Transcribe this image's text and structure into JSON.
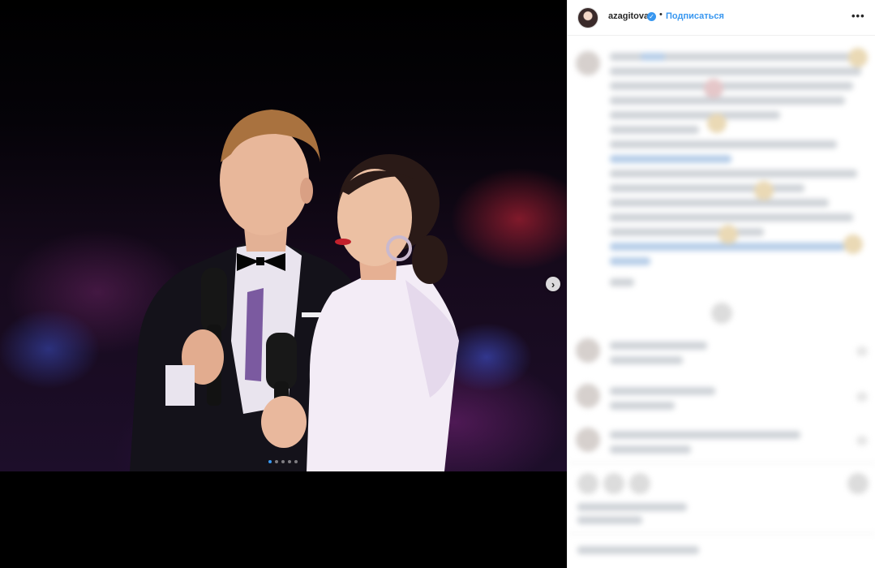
{
  "post": {
    "carousel": {
      "slide_count": 5,
      "active_slide": 1,
      "next_icon": "chevron-right-icon"
    }
  },
  "header": {
    "username": "azagitova",
    "verified_icon": "verified-badge-icon",
    "separator": "•",
    "follow_label": "Подписаться",
    "more_label": "•••",
    "more_icon": "more-options-icon"
  },
  "colors": {
    "link_blue": "#3897f0",
    "text_dark": "#262626",
    "border": "#efefef"
  }
}
